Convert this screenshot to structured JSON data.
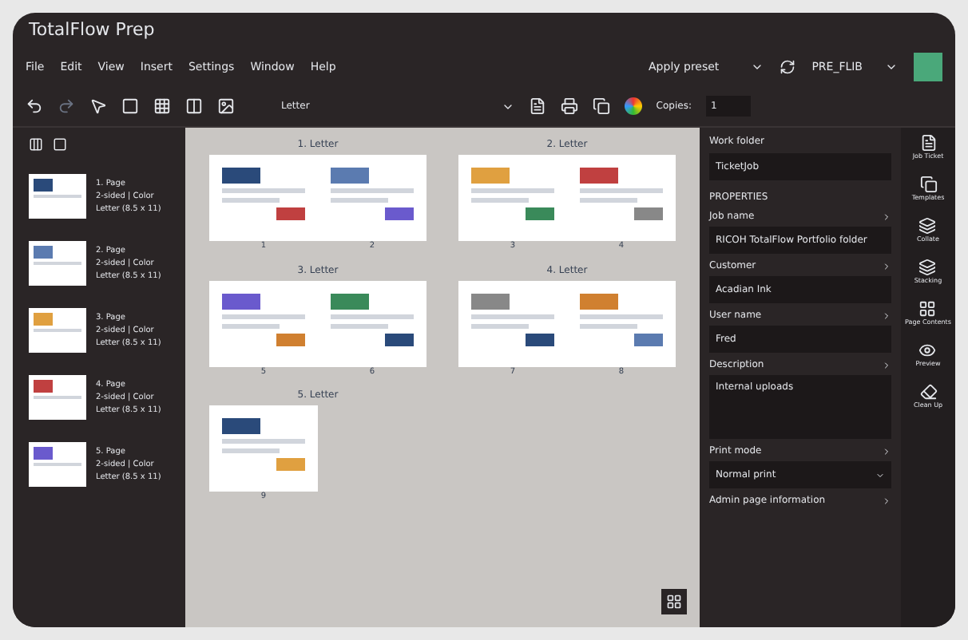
{
  "window": {
    "title": "TotalFlow Prep"
  },
  "menu": [
    "File",
    "Edit",
    "View",
    "Insert",
    "Settings",
    "Window",
    "Help"
  ],
  "preset": {
    "label": "Apply preset"
  },
  "profile": {
    "label": "PRE_FLIB"
  },
  "toolbar": {
    "paper": "Letter",
    "copies_label": "Copies:",
    "copies": "1"
  },
  "pages": [
    {
      "title": "1. Page",
      "sides": "2-sided | Color",
      "size": "Letter (8.5 x 11)",
      "selected": false
    },
    {
      "title": "2. Page",
      "sides": "2-sided | Color",
      "size": "Letter (8.5 x 11)",
      "selected": false
    },
    {
      "title": "3. Page",
      "sides": "2-sided | Color",
      "size": "Letter (8.5 x 11)",
      "selected": false
    },
    {
      "title": "4. Page",
      "sides": "2-sided | Color",
      "size": "Letter (8.5 x 11)",
      "selected": false
    },
    {
      "title": "5. Page",
      "sides": "2-sided | Color",
      "size": "Letter (8.5 x 11)",
      "selected": false
    }
  ],
  "sheets": [
    {
      "title": "1. Letter",
      "numbers": [
        "1",
        "2"
      ]
    },
    {
      "title": "2. Letter",
      "numbers": [
        "3",
        "4"
      ]
    },
    {
      "title": "3. Letter",
      "numbers": [
        "5",
        "6"
      ]
    },
    {
      "title": "4. Letter",
      "numbers": [
        "7",
        "8"
      ]
    },
    {
      "title": "5. Letter",
      "numbers": [
        "9"
      ]
    }
  ],
  "properties": {
    "work_folder_label": "Work folder",
    "work_folder": "TicketJob",
    "heading": "PROPERTIES",
    "fields": [
      {
        "label": "Job name",
        "value": "RICOH TotalFlow Portfolio folder"
      },
      {
        "label": "Customer",
        "value": "Acadian Ink"
      },
      {
        "label": "User name",
        "value": "Fred"
      },
      {
        "label": "Description",
        "value": "Internal uploads",
        "kind": "multiline"
      },
      {
        "label": "Print mode",
        "value": "Normal print",
        "kind": "select"
      }
    ],
    "admin": "Admin page information"
  },
  "tools": [
    "Job Ticket",
    "Templates",
    "Collate",
    "Stacking",
    "Page Contents",
    "Preview",
    "Clean Up"
  ]
}
